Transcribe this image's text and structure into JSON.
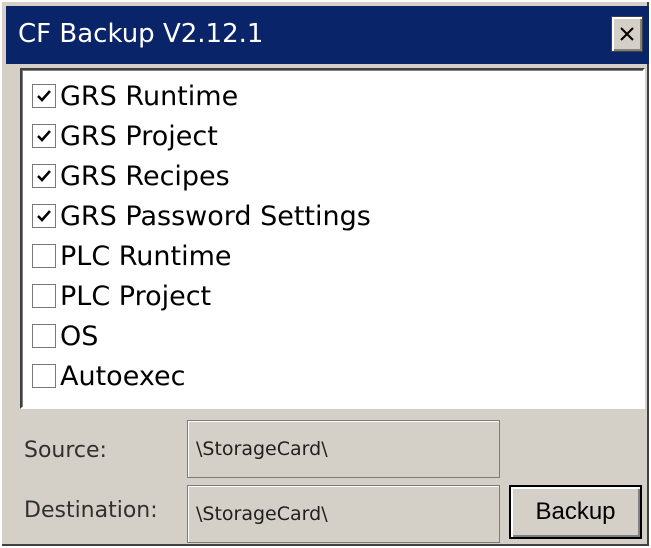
{
  "window": {
    "title": "CF Backup V2.12.1",
    "close_glyph": "×"
  },
  "items": [
    {
      "label": "GRS Runtime",
      "checked": true
    },
    {
      "label": "GRS Project",
      "checked": true
    },
    {
      "label": "GRS Recipes",
      "checked": true
    },
    {
      "label": "GRS Password Settings",
      "checked": true
    },
    {
      "label": "PLC Runtime",
      "checked": false
    },
    {
      "label": "PLC Project",
      "checked": false
    },
    {
      "label": "OS",
      "checked": false
    },
    {
      "label": "Autoexec",
      "checked": false
    }
  ],
  "source": {
    "label": "Source:",
    "value": "\\StorageCard\\"
  },
  "destination": {
    "label": "Destination:",
    "value": "\\StorageCard\\"
  },
  "backup_button": {
    "label": "Backup"
  },
  "colors": {
    "titlebar": "#0a246a",
    "face": "#d4d0c8"
  }
}
